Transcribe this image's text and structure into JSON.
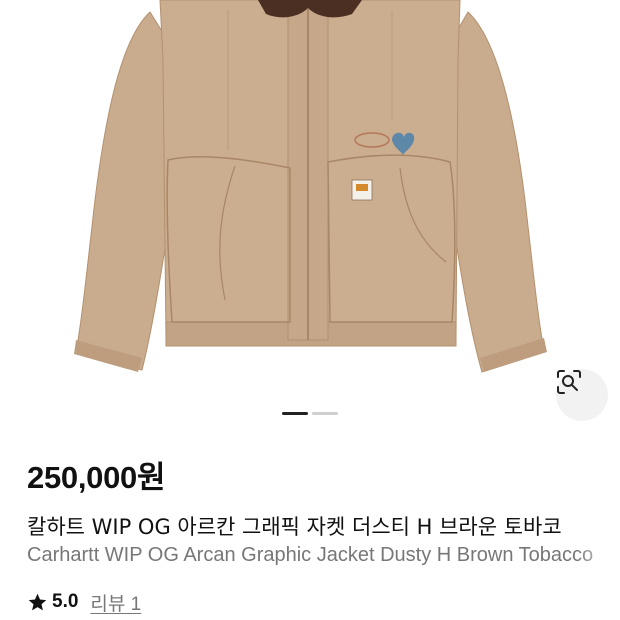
{
  "product": {
    "image_icon": "jacket-product-photo",
    "lens_icon": "image-search-icon",
    "carousel": {
      "current": 1,
      "total": 2
    },
    "price": "250,000원",
    "title_ko": "칼하트 WIP OG 아르칸 그래픽 자켓 더스티 H 브라운 토바코",
    "title_en": "Carhartt WIP OG Arcan Graphic Jacket Dusty H Brown Tobacco",
    "rating": {
      "icon": "star-icon",
      "value": "5.0",
      "review_label": "리뷰 1"
    }
  },
  "colors": {
    "jacket": "#c7a98b",
    "jacket_shadow": "#b08f70",
    "collar": "#4a2f22",
    "heart_patch": "#5d88a8",
    "text_primary": "#111111",
    "text_secondary": "#777777"
  }
}
